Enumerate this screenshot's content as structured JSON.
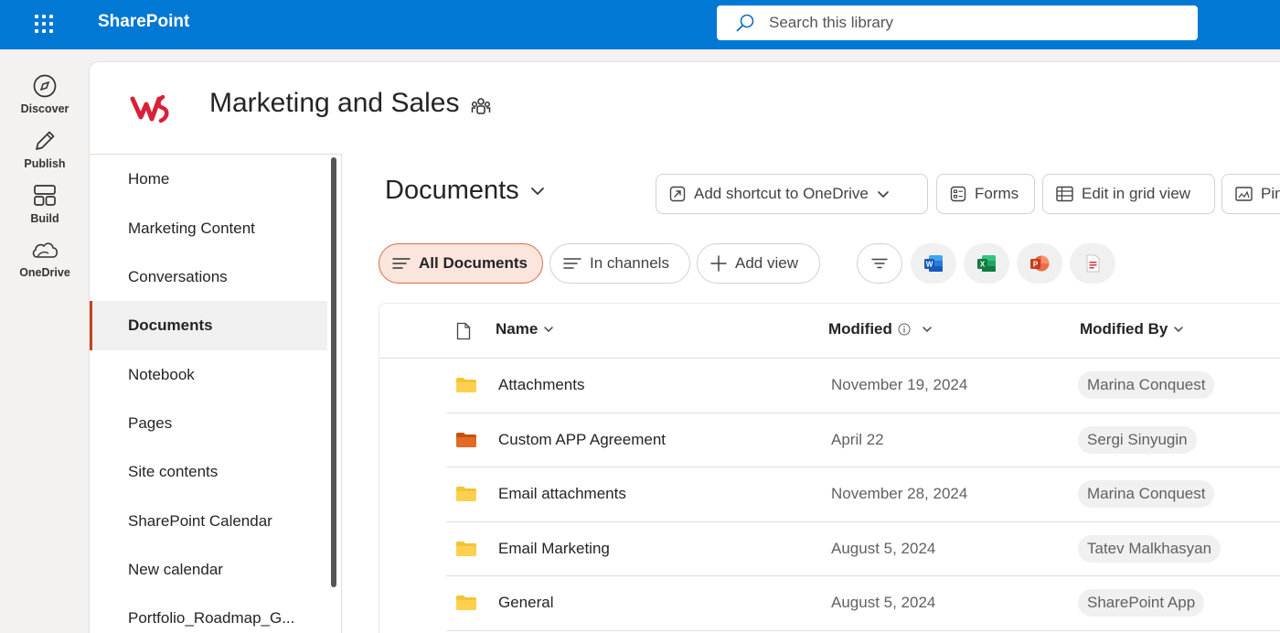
{
  "topbar": {
    "app_name": "SharePoint",
    "search_placeholder": "Search this library"
  },
  "rail": [
    {
      "label": "Discover",
      "icon": "compass-icon"
    },
    {
      "label": "Publish",
      "icon": "pencil-icon"
    },
    {
      "label": "Build",
      "icon": "layout-icon"
    },
    {
      "label": "OneDrive",
      "icon": "cloud-icon"
    }
  ],
  "site": {
    "title": "Marketing and Sales",
    "logo_color": "#d9203a"
  },
  "nav": [
    {
      "label": "Home"
    },
    {
      "label": "Marketing Content"
    },
    {
      "label": "Conversations"
    },
    {
      "label": "Documents",
      "active": true
    },
    {
      "label": "Notebook"
    },
    {
      "label": "Pages"
    },
    {
      "label": "Site contents"
    },
    {
      "label": "SharePoint Calendar"
    },
    {
      "label": "New calendar"
    },
    {
      "label": "Portfolio_Roadmap_G..."
    }
  ],
  "library": {
    "title": "Documents",
    "commands": [
      {
        "label": "Add shortcut to OneDrive",
        "icon": "shortcut-icon"
      },
      {
        "label": "Forms",
        "icon": "forms-icon"
      },
      {
        "label": "Edit in grid view",
        "icon": "grid-icon"
      },
      {
        "label": "Pin",
        "icon": "pin-icon"
      }
    ],
    "views": [
      {
        "label": "All Documents",
        "active": true
      },
      {
        "label": "In channels"
      },
      {
        "label": "Add view"
      }
    ],
    "columns": {
      "name": "Name",
      "modified": "Modified",
      "modified_by": "Modified By"
    },
    "rows": [
      {
        "name": "Attachments",
        "modified": "November 19, 2024",
        "modified_by": "Marina Conquest",
        "folder_color": "#f3c433"
      },
      {
        "name": "Custom APP Agreement",
        "modified": "April 22",
        "modified_by": "Sergi Sinyugin",
        "folder_color": "#e36a25"
      },
      {
        "name": "Email attachments",
        "modified": "November 28, 2024",
        "modified_by": "Marina Conquest",
        "folder_color": "#f3c433"
      },
      {
        "name": "Email Marketing",
        "modified": "August 5, 2024",
        "modified_by": "Tatev Malkhasyan",
        "folder_color": "#f3c433"
      },
      {
        "name": "General",
        "modified": "August 5, 2024",
        "modified_by": "SharePoint App",
        "folder_color": "#f3c433"
      }
    ]
  },
  "colors": {
    "topbar": "#0078d4",
    "accent": "#c4441c",
    "active_view_bg": "#fbe5dc"
  }
}
